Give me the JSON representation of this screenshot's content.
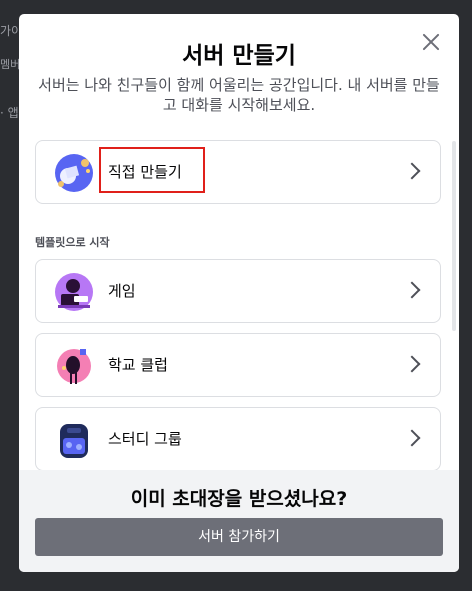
{
  "background": {
    "line1": "가이",
    "line2": "멤버",
    "line3": "· 앱"
  },
  "modal": {
    "title": "서버 만들기",
    "subtitle": "서버는 나와 친구들이 함께 어울리는 공간입니다. 내 서버를 만들고 대화를 시작해보세요.",
    "create_own": {
      "label": "직접 만들기",
      "icon": "create-own-server-icon"
    },
    "template_section_label": "템플릿으로 시작",
    "templates": [
      {
        "label": "게임",
        "icon": "gaming-icon"
      },
      {
        "label": "학교 클럽",
        "icon": "school-club-icon"
      },
      {
        "label": "스터디 그룹",
        "icon": "study-group-icon"
      }
    ],
    "footer": {
      "title": "이미 초대장을 받으셨나요?",
      "join_button": "서버 참가하기"
    }
  },
  "colors": {
    "highlight": "#e0201a",
    "join_button": "#6d6f78",
    "backdrop": "#1e1f22"
  }
}
